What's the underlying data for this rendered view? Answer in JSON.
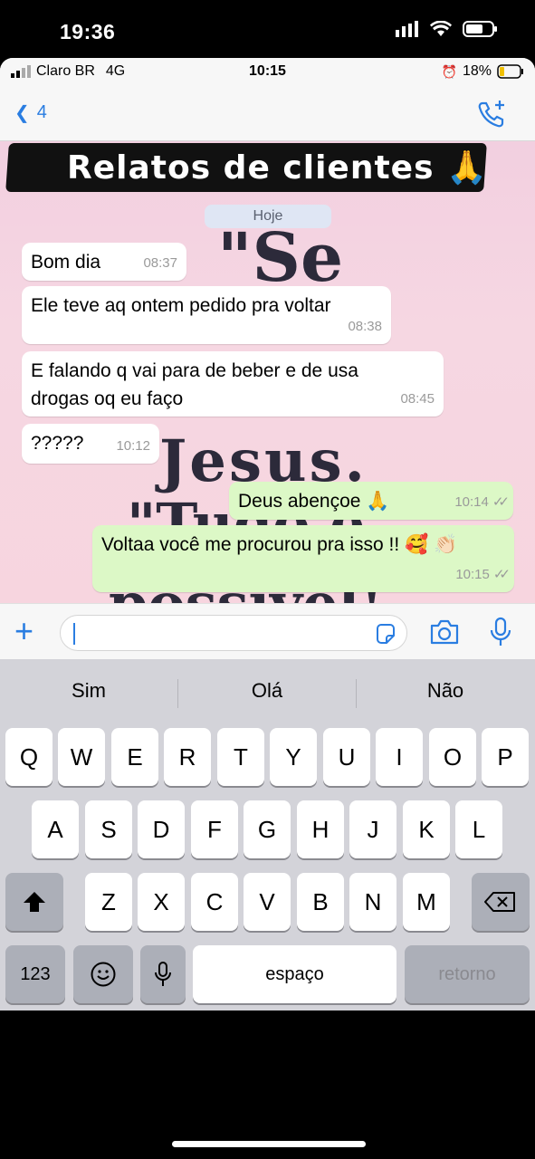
{
  "outer_status": {
    "time": "19:36"
  },
  "inner_status": {
    "carrier": "Claro BR",
    "network": "4G",
    "time": "10:15",
    "battery": "18%"
  },
  "chat_header": {
    "back_count": "4"
  },
  "wallpaper": {
    "word1": "\"Se",
    "word2": "Jesus.",
    "word3": "\"Tudo é",
    "word4": "possível!"
  },
  "banner": {
    "text": "Relatos de clientes 🙏"
  },
  "date_pill": "Hoje",
  "messages": [
    {
      "direction": "in",
      "text": "Bom dia",
      "time": "08:37"
    },
    {
      "direction": "in",
      "text": "Ele teve aq ontem pedido pra voltar",
      "time": "08:38"
    },
    {
      "direction": "in",
      "text": "E falando q vai para de beber e de usa drogas oq eu faço",
      "time": "08:45"
    },
    {
      "direction": "in",
      "text": "?????",
      "time": "10:12"
    },
    {
      "direction": "out",
      "text": "Deus abençoe 🙏",
      "time": "10:14",
      "status": "✓✓"
    },
    {
      "direction": "out",
      "text": "Voltaa você me procurou pra isso !! 🥰 👏🏻",
      "time": "10:15",
      "status": "✓✓"
    }
  ],
  "input": {
    "value": "",
    "placeholder": ""
  },
  "keyboard": {
    "suggestions": [
      "Sim",
      "Olá",
      "Não"
    ],
    "row1": [
      "Q",
      "W",
      "E",
      "R",
      "T",
      "Y",
      "U",
      "I",
      "O",
      "P"
    ],
    "row2": [
      "A",
      "S",
      "D",
      "F",
      "G",
      "H",
      "J",
      "K",
      "L"
    ],
    "row3": [
      "Z",
      "X",
      "C",
      "V",
      "B",
      "N",
      "M"
    ],
    "numbers_key": "123",
    "space_key": "espaço",
    "return_key": "retorno"
  },
  "colors": {
    "accent": "#2a7de1",
    "outgoing_bubble": "#dcf8c6",
    "incoming_bubble": "#ffffff",
    "keyboard_bg": "#d3d3d9"
  }
}
